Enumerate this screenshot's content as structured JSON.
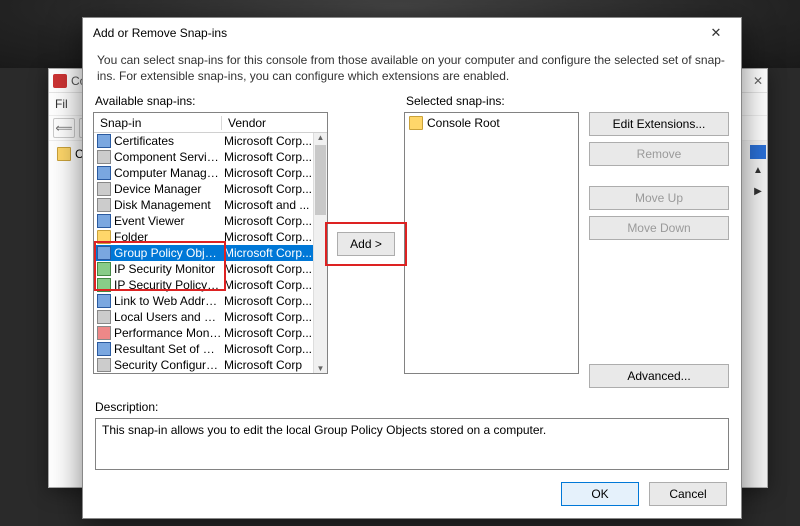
{
  "mmc": {
    "title_fragment": "Co",
    "menu_file": "Fil",
    "tree_root": "Co"
  },
  "dialog": {
    "title": "Add or Remove Snap-ins",
    "description": "You can select snap-ins for this console from those available on your computer and configure the selected set of snap-ins. For extensible snap-ins, you can configure which extensions are enabled.",
    "available_label": "Available snap-ins:",
    "selected_label": "Selected snap-ins:",
    "header_snapin": "Snap-in",
    "header_vendor": "Vendor",
    "snapins": [
      {
        "name": "Certificates",
        "vendor": "Microsoft Corp...",
        "icon": "blue"
      },
      {
        "name": "Component Services",
        "vendor": "Microsoft Corp...",
        "icon": "gray"
      },
      {
        "name": "Computer Managem...",
        "vendor": "Microsoft Corp...",
        "icon": "blue"
      },
      {
        "name": "Device Manager",
        "vendor": "Microsoft Corp...",
        "icon": "gray"
      },
      {
        "name": "Disk Management",
        "vendor": "Microsoft and ...",
        "icon": "gray"
      },
      {
        "name": "Event Viewer",
        "vendor": "Microsoft Corp...",
        "icon": "blue"
      },
      {
        "name": "Folder",
        "vendor": "Microsoft Corp...",
        "icon": "folder"
      },
      {
        "name": "Group Policy Object ...",
        "vendor": "Microsoft Corp...",
        "icon": "blue",
        "selected": true
      },
      {
        "name": "IP Security Monitor",
        "vendor": "Microsoft Corp...",
        "icon": "green"
      },
      {
        "name": "IP Security Policy Ma...",
        "vendor": "Microsoft Corp...",
        "icon": "green"
      },
      {
        "name": "Link to Web Address",
        "vendor": "Microsoft Corp...",
        "icon": "blue"
      },
      {
        "name": "Local Users and Gro...",
        "vendor": "Microsoft Corp...",
        "icon": "gray"
      },
      {
        "name": "Performance Monitor",
        "vendor": "Microsoft Corp...",
        "icon": "red"
      },
      {
        "name": "Resultant Set of Policy",
        "vendor": "Microsoft Corp...",
        "icon": "blue"
      },
      {
        "name": "Security Configuratio",
        "vendor": "Microsoft Corp",
        "icon": "gray"
      }
    ],
    "selected_root": "Console Root",
    "btn_add": "Add >",
    "btn_edit_ext": "Edit Extensions...",
    "btn_remove": "Remove",
    "btn_move_up": "Move Up",
    "btn_move_down": "Move Down",
    "btn_advanced": "Advanced...",
    "desc_label": "Description:",
    "desc_text": "This snap-in allows you to edit the local Group Policy Objects stored on a computer.",
    "btn_ok": "OK",
    "btn_cancel": "Cancel"
  }
}
